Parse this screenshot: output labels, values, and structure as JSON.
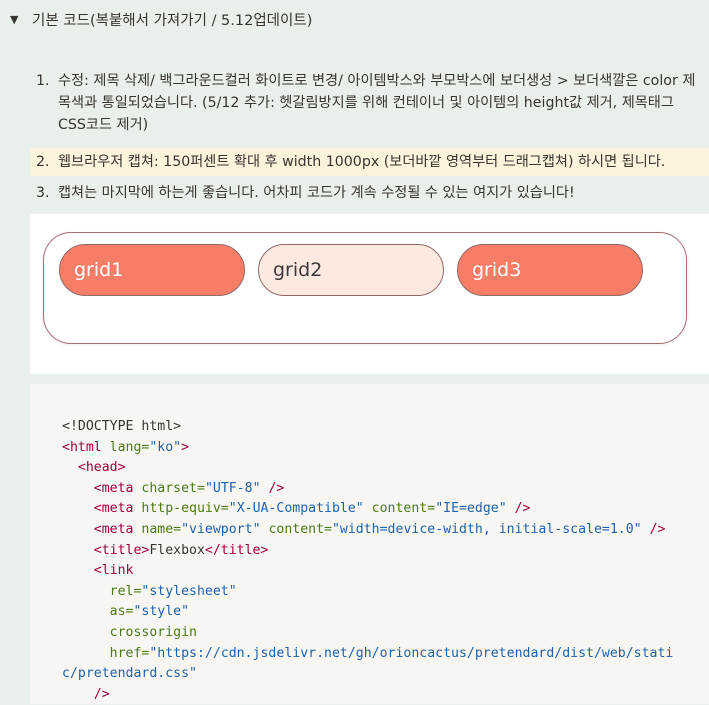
{
  "toggle": {
    "arrow": "▼",
    "title": "기본 코드(복붙해서 가져가기 / 5.12업데이트)"
  },
  "list": [
    {
      "num": "1.",
      "text": "수정: 제목 삭제/ 백그라운드컬러 화이트로 변경/ 아이템박스와 부모박스에 보더생성 > 보더색깔은 color 제목색과 통일되었습니다. (5/12 추가: 헷갈림방지를 위해 컨테이너 및 아이템의 height값 제거, 제목태그 CSS코드 제거)"
    },
    {
      "num": "2.",
      "text": "웹브라우저 캡쳐: 150퍼센트 확대 후 width 1000px (보더바깥 영역부터 드래그캡쳐) 하시면 됩니다."
    },
    {
      "num": "3.",
      "text": "캡쳐는 마지막에 하는게 좋습니다. 어차피 코드가 계속 수정될 수 있는 여지가 있습니다!"
    }
  ],
  "preview": {
    "grids": [
      "grid1",
      "grid2",
      "grid3"
    ]
  },
  "code": {
    "l1": "<!DOCTYPE html>",
    "l2_open": "<html",
    "l2_attr": " lang=",
    "l2_val": "\"ko\"",
    "l2_close": ">",
    "l3": "<head>",
    "l4_tag": "<meta",
    "l4_attr": " charset=",
    "l4_val": "\"UTF-8\"",
    "l4_end": " />",
    "l5_tag": "<meta",
    "l5_attr1": " http-equiv=",
    "l5_val1": "\"X-UA-Compatible\"",
    "l5_attr2": " content=",
    "l5_val2": "\"IE=edge\"",
    "l5_end": " />",
    "l6_tag": "<meta",
    "l6_attr1": " name=",
    "l6_val1": "\"viewport\"",
    "l6_attr2": " content=",
    "l6_val2": "\"width=device-width, initial-scale=1.0\"",
    "l6_end": " />",
    "l7_open": "<title>",
    "l7_text": "Flexbox",
    "l7_close": "</title>",
    "l8": "<link",
    "l9_attr": "rel=",
    "l9_val": "\"stylesheet\"",
    "l10_attr": "as=",
    "l10_val": "\"style\"",
    "l11_attr": "crossorigin",
    "l12_attr": "href=",
    "l12_val": "\"https://cdn.jsdelivr.net/gh/orioncactus/pretendard/dist/web/stati",
    "l13_val": "c/pretendard.css\"",
    "l14": "/>"
  }
}
